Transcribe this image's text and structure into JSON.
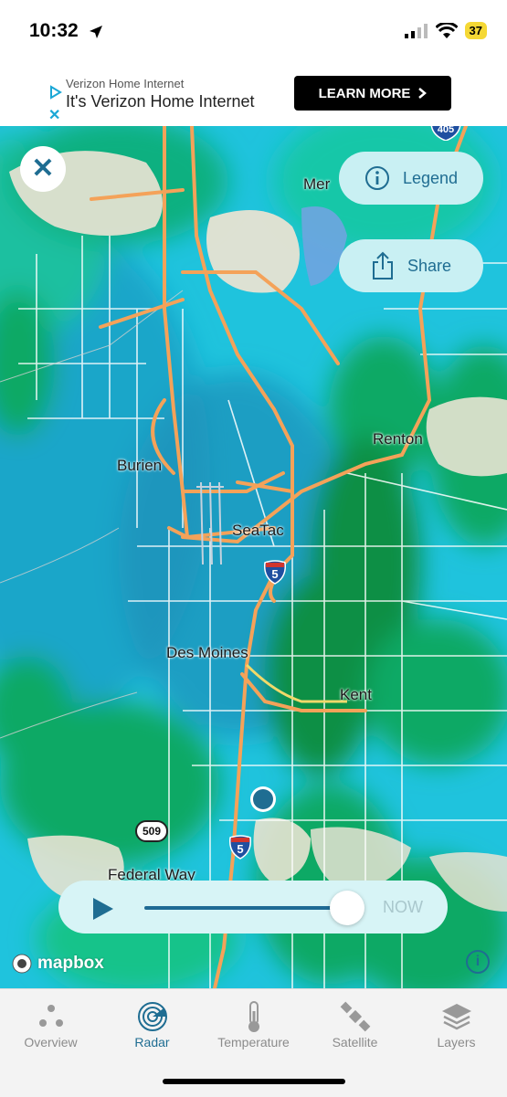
{
  "status_bar": {
    "time": "10:32",
    "battery": "37"
  },
  "ad": {
    "line1": "Verizon Home Internet",
    "line2": "It's Verizon Home Internet",
    "button_label": "LEARN MORE",
    "close_glyph": "✕"
  },
  "map": {
    "labels": {
      "mer": "Mer",
      "burien": "Burien",
      "renton": "Renton",
      "seatac": "SeaTac",
      "des_moines": "Des Moines",
      "kent": "Kent",
      "federal_way": "Federal Way"
    },
    "shields": {
      "i5_upper": "5",
      "i5_lower": "5",
      "i405": "405",
      "r509": "509"
    }
  },
  "controls": {
    "close_glyph": "✕",
    "legend_label": "Legend",
    "share_label": "Share",
    "now_label": "NOW",
    "attribution": "mapbox",
    "info_glyph": "i",
    "timeline_progress": 1.0
  },
  "tabbar": {
    "active": "Radar",
    "tabs": [
      {
        "label": "Overview",
        "icon": "overview-icon"
      },
      {
        "label": "Radar",
        "icon": "radar-icon"
      },
      {
        "label": "Temperature",
        "icon": "thermometer-icon"
      },
      {
        "label": "Satellite",
        "icon": "satellite-icon"
      },
      {
        "label": "Layers",
        "icon": "layers-icon"
      }
    ]
  },
  "colors": {
    "accent": "#1f6d92",
    "radar_light": "#1fc3dd",
    "radar_green": "#0c9a5a"
  }
}
